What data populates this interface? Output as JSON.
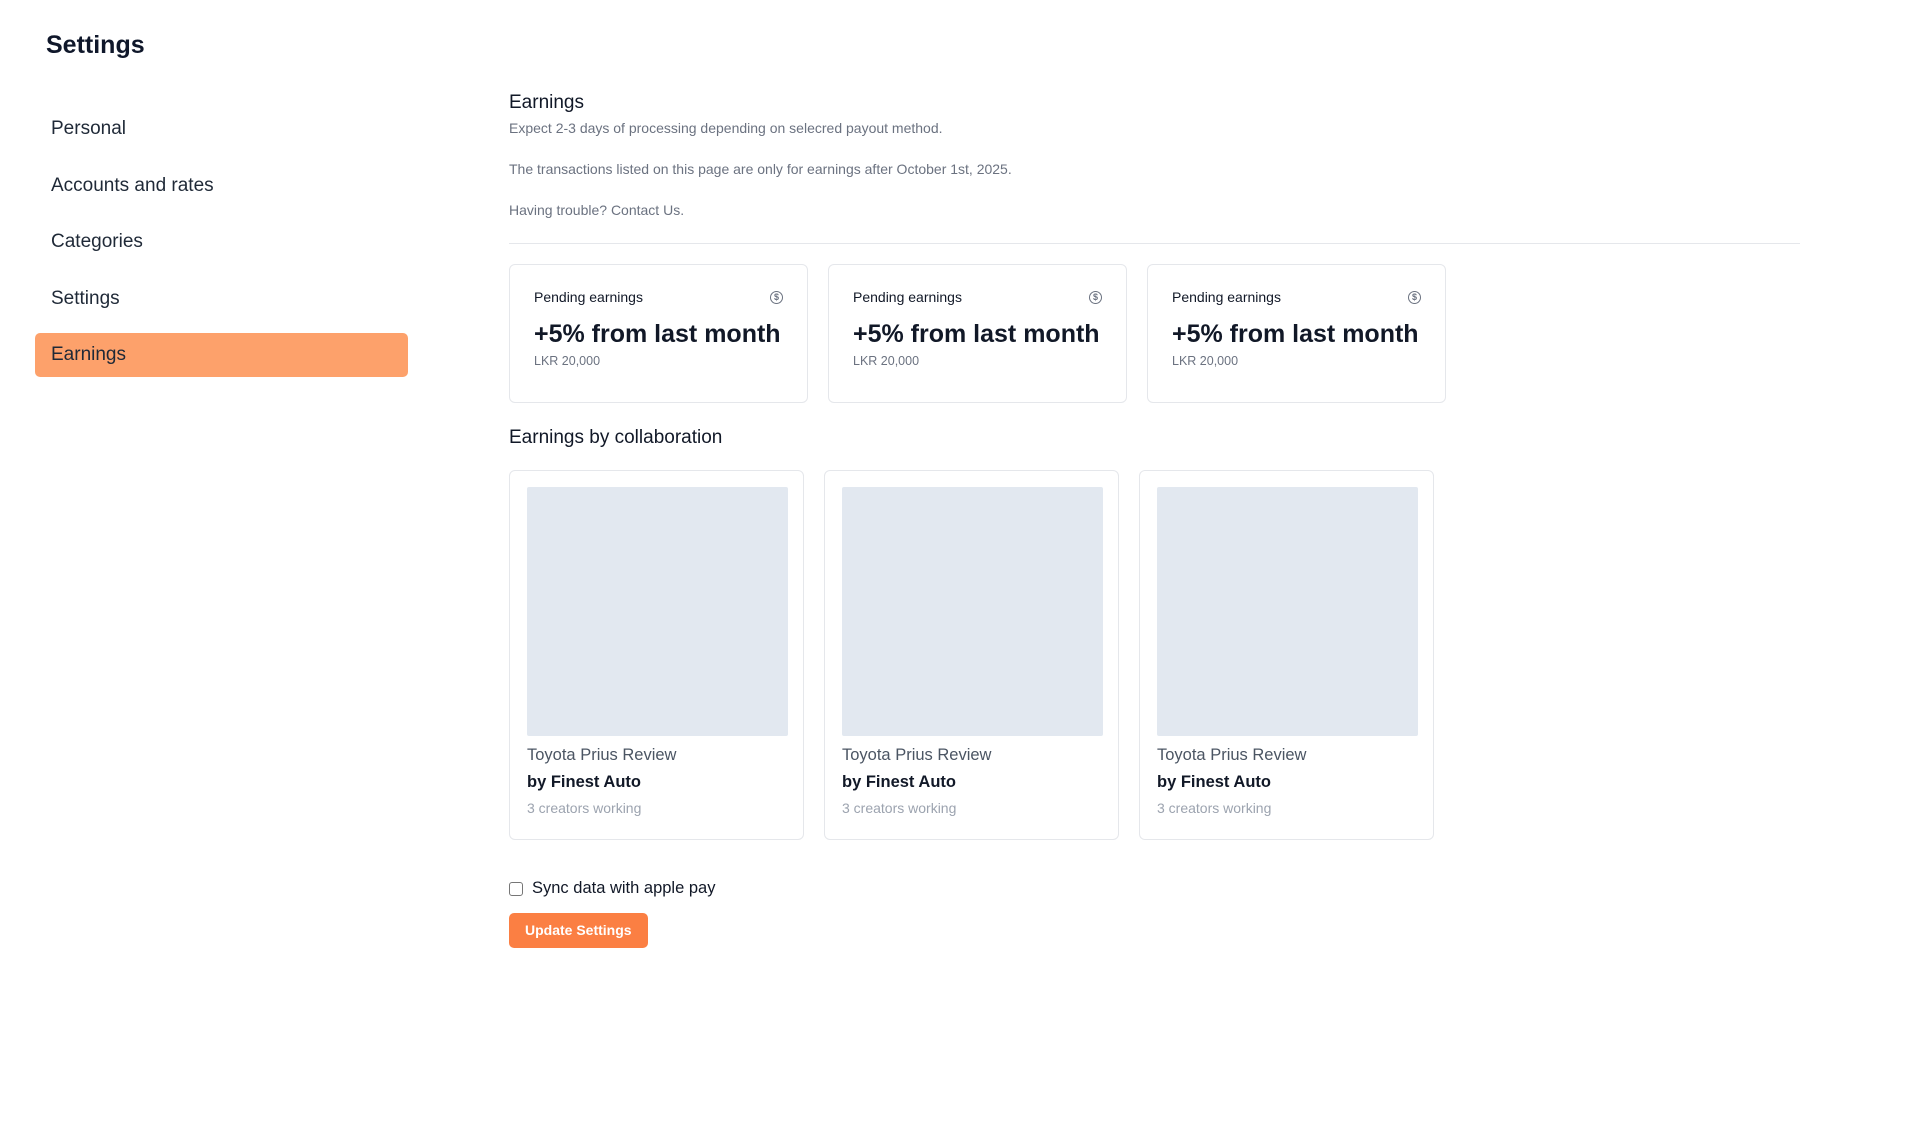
{
  "header": {
    "title": "Settings"
  },
  "sidebar": {
    "items": [
      {
        "label": "Personal",
        "active": false
      },
      {
        "label": "Accounts and rates",
        "active": false
      },
      {
        "label": "Categories",
        "active": false
      },
      {
        "label": "Settings",
        "active": false
      },
      {
        "label": "Earnings",
        "active": true
      }
    ]
  },
  "earnings": {
    "title": "Earnings",
    "descriptions": [
      "Expect 2-3 days of processing depending on selecred payout method.",
      "The transactions listed on this page are only for earnings after October 1st, 2025.",
      "Having trouble? Contact Us."
    ]
  },
  "stats": [
    {
      "label": "Pending earnings",
      "icon": "dollar-circle-icon",
      "value": "+5% from last month",
      "sub": "LKR 20,000"
    },
    {
      "label": "Pending earnings",
      "icon": "dollar-circle-icon",
      "value": "+5% from last month",
      "sub": "LKR 20,000"
    },
    {
      "label": "Pending earnings",
      "icon": "dollar-circle-icon",
      "value": "+5% from last month",
      "sub": "LKR 20,000"
    }
  ],
  "collaborations": {
    "title": "Earnings by collaboration",
    "items": [
      {
        "name": "Toyota Prius Review",
        "by": "by Finest Auto",
        "meta": "3 creators working"
      },
      {
        "name": "Toyota Prius Review",
        "by": "by Finest Auto",
        "meta": "3 creators working"
      },
      {
        "name": "Toyota Prius Review",
        "by": "by Finest Auto",
        "meta": "3 creators working"
      }
    ]
  },
  "sync": {
    "label": "Sync data with apple pay",
    "checked": false
  },
  "actions": {
    "update_label": "Update Settings"
  },
  "colors": {
    "accent": "#fb7f43",
    "active_nav": "#fda16b",
    "placeholder": "#e2e8f0",
    "border": "#e5e7eb"
  }
}
